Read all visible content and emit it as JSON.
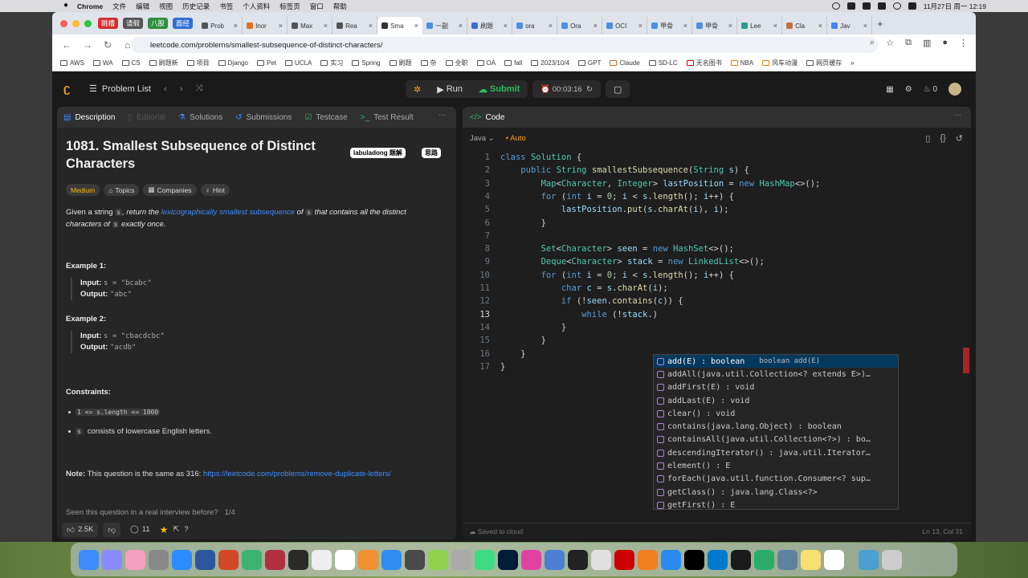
{
  "menubar": {
    "app": "Chrome",
    "items": [
      "文件",
      "编辑",
      "视图",
      "历史记录",
      "书签",
      "个人资料",
      "标签页",
      "窗口",
      "帮助"
    ],
    "clock": "11月27日 周一  12:19"
  },
  "browser": {
    "colored_tabs": [
      {
        "label": "跳槽",
        "color": "#d03030"
      },
      {
        "label": "请假",
        "color": "#555"
      },
      {
        "label": "八股",
        "color": "#2f8f3f"
      },
      {
        "label": "面经",
        "color": "#2f6fd0"
      }
    ],
    "tabs": [
      "Prob",
      "Inor",
      "Max",
      "Rea",
      "Sma",
      "一副",
      "刷题",
      "ora",
      "Ora",
      "OCI",
      "甲骨",
      "甲骨",
      "Lee",
      "Cla",
      "Jav"
    ],
    "active_tab_index": 4,
    "url": "leetcode.com/problems/smallest-subsequence-of-distinct-characters/",
    "bookmarks": [
      "AWS",
      "WA",
      "CS",
      "刷题新",
      "项目",
      "Django",
      "Pet",
      "UCLA",
      "实习",
      "Spring",
      "刷题",
      "杂",
      "全职",
      "OA",
      "fall",
      "2023/10/4",
      "GPT",
      "Claude",
      "SD-LC",
      "无名图书",
      "NBA",
      "风车动漫",
      "网页缓存"
    ]
  },
  "topbar": {
    "problem_list": "Problem List",
    "run": "Run",
    "submit": "Submit",
    "timer": "00:03:16",
    "fire_count": "0"
  },
  "left": {
    "tabs": [
      "Description",
      "Editorial",
      "Solutions",
      "Submissions",
      "Testcase",
      "Test Result"
    ],
    "title": "1081. Smallest Subsequence of Distinct Characters",
    "badge1": "labuladong 题解",
    "badge2": "思路",
    "difficulty": "Medium",
    "topics": "Topics",
    "companies": "Companies",
    "hint": "Hint",
    "desc": {
      "a": "Given a string ",
      "s1": "s",
      "b": ", return the ",
      "link": "lexicographically smallest subsequence",
      "c": " of ",
      "s2": "s",
      "d": " that contains all the distinct characters of ",
      "s3": "s",
      "e": " exactly once."
    },
    "ex1": {
      "head": "Example 1:",
      "in_label": "Input:",
      "in": "s = \"bcabc\"",
      "out_label": "Output:",
      "out": "\"abc\""
    },
    "ex2": {
      "head": "Example 2:",
      "in_label": "Input:",
      "in": "s = \"cbacdcbc\"",
      "out_label": "Output:",
      "out": "\"acdb\""
    },
    "constraints": "Constraints:",
    "c1": "1 <= s.length <= 1000",
    "c2_code": "s",
    "c2": "consists of lowercase English letters.",
    "note_label": "Note:",
    "note": "This question is the same as 316: ",
    "note_link": "https://leetcode.com/problems/remove-duplicate-letters/",
    "seen": "Seen this question in a real interview before?",
    "seen_page": "1/4",
    "likes": "2.5K",
    "comments": "11"
  },
  "right": {
    "tab": "Code",
    "lang": "Java",
    "auto": "Auto",
    "saved": "Saved to cloud",
    "cursor": "Ln 13, Col 31",
    "lines": [
      "1",
      "2",
      "3",
      "4",
      "5",
      "6",
      "7",
      "8",
      "9",
      "10",
      "11",
      "12",
      "13",
      "14",
      "15",
      "16",
      "17"
    ],
    "autocomplete": [
      {
        "label": "add(E) : boolean",
        "detail": "boolean add(E)"
      },
      {
        "label": "addAll(java.util.Collection<? extends E>)…",
        "detail": ""
      },
      {
        "label": "addFirst(E) : void",
        "detail": ""
      },
      {
        "label": "addLast(E) : void",
        "detail": ""
      },
      {
        "label": "clear() : void",
        "detail": ""
      },
      {
        "label": "contains(java.lang.Object) : boolean",
        "detail": ""
      },
      {
        "label": "containsAll(java.util.Collection<?>) : bo…",
        "detail": ""
      },
      {
        "label": "descendingIterator() : java.util.Iterator…",
        "detail": ""
      },
      {
        "label": "element() : E",
        "detail": ""
      },
      {
        "label": "forEach(java.util.function.Consumer<? sup…",
        "detail": ""
      },
      {
        "label": "getClass() : java.lang.Class<?>",
        "detail": ""
      },
      {
        "label": "getFirst() : E",
        "detail": ""
      }
    ]
  }
}
